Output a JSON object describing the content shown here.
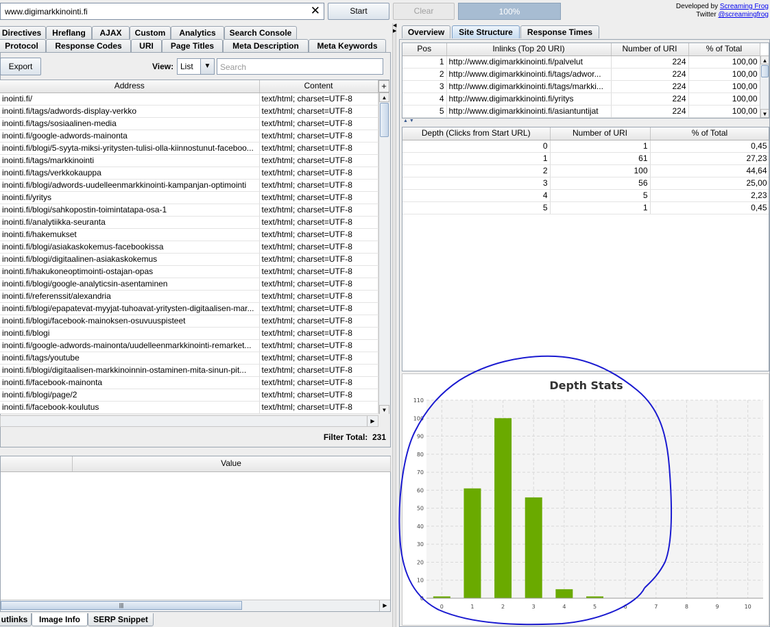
{
  "toolbar": {
    "url_value": "www.digimarkkinointi.fi",
    "start_label": "Start",
    "clear_label": "Clear",
    "progress_label": "100%",
    "progress_fraction": 1.0,
    "developed_by": "Developed by",
    "developer_link": "Screaming Frog",
    "twitter_label": "Twitter",
    "twitter_link": "@screamingfrog"
  },
  "left_tabs_row1": [
    "Directives",
    "Hreflang",
    "AJAX",
    "Custom",
    "Analytics",
    "Search Console"
  ],
  "left_tabs_row2": [
    "Protocol",
    "Response Codes",
    "URI",
    "Page Titles",
    "Meta Description",
    "Meta Keywords"
  ],
  "left_toolbar": {
    "export_label": "Export",
    "view_label": "View:",
    "view_value": "List",
    "search_placeholder": "Search"
  },
  "main_table": {
    "headers": [
      "Address",
      "Content"
    ],
    "rows": [
      [
        "inointi.fi/",
        "text/html; charset=UTF-8"
      ],
      [
        "inointi.fi/tags/adwords-display-verkko",
        "text/html; charset=UTF-8"
      ],
      [
        "inointi.fi/tags/sosiaalinen-media",
        "text/html; charset=UTF-8"
      ],
      [
        "inointi.fi/google-adwords-mainonta",
        "text/html; charset=UTF-8"
      ],
      [
        "inointi.fi/blogi/5-syyta-miksi-yritysten-tulisi-olla-kiinnostunut-faceboo...",
        "text/html; charset=UTF-8"
      ],
      [
        "inointi.fi/tags/markkinointi",
        "text/html; charset=UTF-8"
      ],
      [
        "inointi.fi/tags/verkkokauppa",
        "text/html; charset=UTF-8"
      ],
      [
        "inointi.fi/blogi/adwords-uudelleenmarkkinointi-kampanjan-optimointi",
        "text/html; charset=UTF-8"
      ],
      [
        "inointi.fi/yritys",
        "text/html; charset=UTF-8"
      ],
      [
        "inointi.fi/blogi/sahkopostin-toimintatapa-osa-1",
        "text/html; charset=UTF-8"
      ],
      [
        "inointi.fi/analytiikka-seuranta",
        "text/html; charset=UTF-8"
      ],
      [
        "inointi.fi/hakemukset",
        "text/html; charset=UTF-8"
      ],
      [
        "inointi.fi/blogi/asiakaskokemus-facebookissa",
        "text/html; charset=UTF-8"
      ],
      [
        "inointi.fi/blogi/digitaalinen-asiakaskokemus",
        "text/html; charset=UTF-8"
      ],
      [
        "inointi.fi/hakukoneoptimointi-ostajan-opas",
        "text/html; charset=UTF-8"
      ],
      [
        "inointi.fi/blogi/google-analyticsin-asentaminen",
        "text/html; charset=UTF-8"
      ],
      [
        "inointi.fi/referenssit/alexandria",
        "text/html; charset=UTF-8"
      ],
      [
        "inointi.fi/blogi/epapatevat-myyjat-tuhoavat-yritysten-digitaalisen-mar...",
        "text/html; charset=UTF-8"
      ],
      [
        "inointi.fi/blogi/facebook-mainoksen-osuvuuspisteet",
        "text/html; charset=UTF-8"
      ],
      [
        "inointi.fi/blogi",
        "text/html; charset=UTF-8"
      ],
      [
        "inointi.fi/google-adwords-mainonta/uudelleenmarkkinointi-remarket...",
        "text/html; charset=UTF-8"
      ],
      [
        "inointi.fi/tags/youtube",
        "text/html; charset=UTF-8"
      ],
      [
        "inointi.fi/blogi/digitaalisen-markkinoinnin-ostaminen-mita-sinun-pit...",
        "text/html; charset=UTF-8"
      ],
      [
        "inointi.fi/facebook-mainonta",
        "text/html; charset=UTF-8"
      ],
      [
        "inointi.fi/blogi/page/2",
        "text/html; charset=UTF-8"
      ],
      [
        "inointi.fi/facebook-koulutus",
        "text/html; charset=UTF-8"
      ]
    ],
    "filter_total_label": "Filter Total:",
    "filter_total_value": "231"
  },
  "lower_table": {
    "headers": [
      "",
      "Value"
    ]
  },
  "bottom_tabs": [
    "utlinks",
    "Image Info",
    "SERP Snippet"
  ],
  "right_tabs": [
    "Overview",
    "Site Structure",
    "Response Times"
  ],
  "inlinks_table": {
    "headers": [
      "Pos",
      "Inlinks (Top 20 URI)",
      "Number of URI",
      "% of Total"
    ],
    "rows": [
      [
        "1",
        "http://www.digimarkkinointi.fi/palvelut",
        "224",
        "100,00"
      ],
      [
        "2",
        "http://www.digimarkkinointi.fi/tags/adwor...",
        "224",
        "100,00"
      ],
      [
        "3",
        "http://www.digimarkkinointi.fi/tags/markki...",
        "224",
        "100,00"
      ],
      [
        "4",
        "http://www.digimarkkinointi.fi/yritys",
        "224",
        "100,00"
      ],
      [
        "5",
        "http://www.digimarkkinointi.fi/asiantuntijat",
        "224",
        "100,00"
      ]
    ]
  },
  "depth_table": {
    "headers": [
      "Depth (Clicks from Start URL)",
      "Number of URI",
      "% of Total"
    ],
    "rows": [
      [
        "0",
        "1",
        "0,45"
      ],
      [
        "1",
        "61",
        "27,23"
      ],
      [
        "2",
        "100",
        "44,64"
      ],
      [
        "3",
        "56",
        "25,00"
      ],
      [
        "4",
        "5",
        "2,23"
      ],
      [
        "5",
        "1",
        "0,45"
      ]
    ]
  },
  "chart_data": {
    "type": "bar",
    "title": "Depth Stats",
    "categories": [
      "0",
      "1",
      "2",
      "3",
      "4",
      "5",
      "6",
      "7",
      "8",
      "9",
      "10"
    ],
    "values": [
      1,
      61,
      100,
      56,
      5,
      1,
      0,
      0,
      0,
      0,
      0
    ],
    "xlabel": "",
    "ylabel": "",
    "ylim": [
      0,
      110
    ],
    "yticks": [
      0,
      10,
      20,
      30,
      40,
      50,
      60,
      70,
      80,
      90,
      100,
      110
    ],
    "grid": true,
    "bar_color": "#6aaa00"
  },
  "colors": {
    "accent": "#7a9cc4",
    "annotation": "#1a1ad0",
    "link": "#0000ee"
  }
}
